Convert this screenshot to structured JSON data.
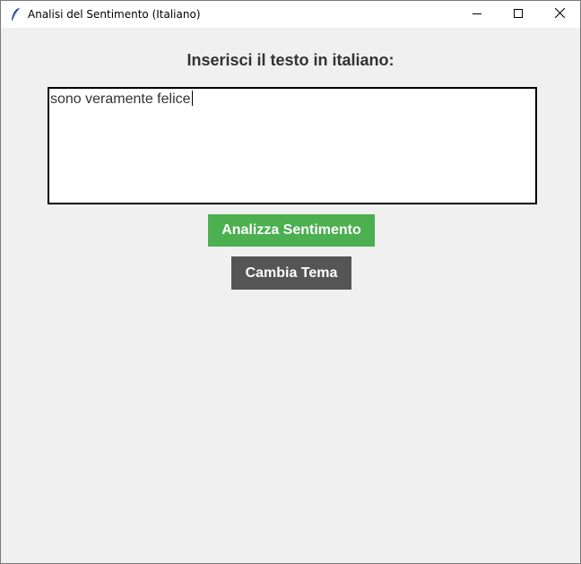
{
  "window": {
    "title": "Analisi del Sentimento (Italiano)",
    "app_icon": "feather-icon",
    "controls": [
      "minimize-icon",
      "maximize-icon",
      "close-icon"
    ]
  },
  "main": {
    "heading": "Inserisci il testo in italiano:",
    "text_input_value": "sono veramente felice",
    "analyze_button_label": "Analizza Sentimento",
    "theme_button_label": "Cambia Tema"
  },
  "colors": {
    "background": "#f0f0f0",
    "analyze_button": "#4caf50",
    "theme_button": "#555555",
    "heading_text": "#333333"
  }
}
